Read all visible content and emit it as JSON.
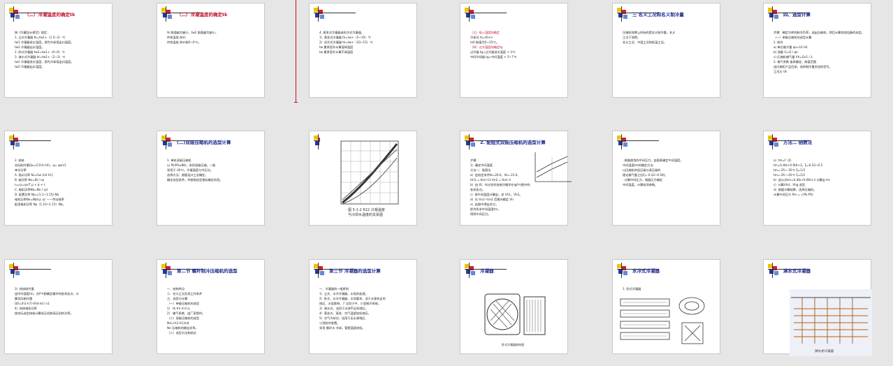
{
  "slides": [
    {
      "title": "（二）冷凝温度的确定tk",
      "title_red": true,
      "lines": [
        "按《冷藏设计规范》规定：",
        "1. 立式冷凝器  tk=tw1+（1.5~3）℃",
        "tw1  冷凝器进水温度，即为冷却塔出口温度。",
        "tw2  冷凝器出水温度。",
        "2. 卧式冷凝器   tw2=tw1+（4~6）℃",
        "3. 淋水式冷凝器   tk=tw1+（2~3）℃",
        "tw1  冷凝器进水温度，即为冷却塔出口温度。",
        "tw2  冷凝器出水温度。"
      ]
    },
    {
      "title": "（二）冷凝温度的确定tk",
      "title_red": true,
      "lines": [
        "tk 取值越大越小，tw2 取值越大越小。",
        "传热温差  Δtm",
        "",
        "",
        "",
        "",
        "",
        "   传热温差  Δtm取5~6℃。"
      ]
    },
    {
      "title": "",
      "lines": [
        "4. 蒸发式冷凝器或风冷式冷凝器。",
        "1）蒸发式冷凝器  tk=tw+（5~10）℃",
        "2）风冷式冷凝器  tk=tw+（10~15）℃",
        "tw  夏季室外计算湿球温度",
        "tw  夏季室外计算干球温度"
      ]
    },
    {
      "title": "",
      "lines": [
        "（三）吸入温度的确定",
        "    冷却式  tx=t0+n",
        "    tx0  取值为5~15℃。",
        "",
        "（四）过冷温度的确定tg",
        "    过冷器  tg=过冷器进水温度 + 3℃",
        "    中间冷却器  tg=中间温度 + 5~7℃"
      ]
    },
    {
      "title": "三  名义工况和名义制冷量",
      "lines": [
        "    压缩机铭牌上所标的是名义制冷量。名义",
        "工况下测得。",
        "    名义工况、中温工况和低温工况。"
      ]
    },
    {
      "title": "四、选型计算",
      "lines": [
        "步骤：确定冷库的制冷负荷，选出压缩机，然后计算其他设备的选型。",
        "（一）单级压缩机的选型计算",
        "1. 制冷",
        "a) 单位制冷量  qe=h1-h4",
        "b) 流量  G=Q / qe",
        "c) 压缩机输气量  Vh=Gv1 / λ",
        "2. 输气系数  查表确定，取值范围",
        "   由压缩机产品目录，选择制冷量合适的型号。",
        "工况与 Vh"
      ]
    },
    {
      "title": "",
      "lines": [
        "2. 校核",
        "   实际制冷量Qe=G'(h1-h4)，q= qe/v1",
        "   单位功率",
        "A. 指示功率  Ni=Gw (h2-h1)",
        "B. 轴功率  Ne=Ni / ηe",
        "   n=ηi=ηe/T  p + b + t",
        "C. 电机功率Nb=Ne / ηd",
        "D. 配置功率 Np=(1.1~1.15) Nb",
        "   电机功率Ne=Nb/ηc              ηc ——传动效率",
        "   配用电机功率 Np（1.10~1.15）Nb。"
      ]
    },
    {
      "title": "(二)双级压缩机的选型计算",
      "lines": [
        "1. 单机双级压缩机",
        "   以 Pk/P0≥8时，采用双级压缩。一般",
        "采用于-30℃。冷凝温度与中压比。",
        "   选择方法：根据设计工况确定，",
        "确定选型条件。并按照选型指标确定机型。"
      ]
    },
    {
      "title": "",
      "lines": []
    },
    {
      "title": "2. 配组式双级压缩机的选型计算",
      "lines": [
        "步骤：",
        "1）确定中间温度",
        "方法一：画图法",
        "a）由给定条件tk=20.0、t0=-23.0、",
        "   tm1 = tkm-13     tm2 = tkm-3",
        "b）由 t0、tk分别作各制冷循环在lgP-h图中的",
        "   各状态点。",
        "c）按中间温度计算出，求 Vh1，Vh2。",
        "d）在 tm1~tm2 范围内确定 Vh",
        "e）由图中得出交点，",
        "   即为所求中间温度tm，",
        "   得到中间压力。"
      ]
    },
    {
      "title": "",
      "lines": [
        "· 根据使用的中间压力，由图表确定中间温度。",
        "  中间温度tm的确定方法：",
        "  以压缩机的低压级与高压级的",
        "  理论输气量之比ξ= 0.33~0.5时。",
        "· 计算中间压力，根据压力确定",
        "  中间温度，计算各项参数。"
      ]
    },
    {
      "title": "方法二 函数法",
      "lines": [
        "a）tm=f（ξ）",
        "   tm=0.4tk+0.6t0+3，ξ=0.33~0.5",
        "   tm=-25~-35℃  ξ=1/3",
        "   tm=-35~-45℃  ξ=1/2",
        "b）由公式tm=0.4tk+0.6t0+3 计算出 tm",
        "c）计算Vhd，Vhg  选型",
        "d）根据计算结果，选择压缩机。",
        "   计算中间压力 Pm = √(Pk·P0)"
      ]
    },
    {
      "title": "",
      "lines": [
        "3）校核制冷量",
        "   由中间温度tm，在P-h图确定循环的各状态点，计",
        "   算实际制冷量",
        "Q0=(h1-h7)·Vhd·λd / v1",
        "4）校核电机功率",
        "   按实际选型校核计算低压机和高压机的功率。"
      ]
    },
    {
      "title": "第二节 螺杆制冷压缩机的选型",
      "lines": [
        "一、结构特点",
        "二、名义工况及其工作条件",
        "三、选型与计算",
        "（一）单级压缩机的选型",
        "1）      tk  tm  m·h·η",
        "2）  输气系数、由厂家提供。",
        "（二）双级压缩机的选型",
        "  Nd=(h2-h1)/ηd",
        "  Ne    压缩机的输出功率。",
        "（二）选型方法和结论"
      ]
    },
    {
      "title": "第三节 冷凝器的选型计算",
      "lines": [
        "一、冷凝器的一般原则",
        "1）立式、水冷冷凝器、水垢的处理。",
        "2）卧式、水冷冷凝器、水质要求、适于水源充足的",
        "   地区、水垢影响、广泛用于中、小型制冷系统。",
        "3）淋水式、适用于水源不足的地区。",
        "4）蒸发式、蒸发、空气温度较低地区。",
        "5）空气冷却式、适用于无水源地区、",
        "   小型制冷装置。",
        "采用 循环水 冷却，管壁温度较低。"
      ]
    },
    {
      "title": "冷凝器",
      "lines": []
    },
    {
      "title": "水冷式冷凝器",
      "lines": [
        "1. 卧式冷凝器"
      ]
    },
    {
      "title": "淋水式冷凝器",
      "lines": []
    }
  ],
  "figure_captions": {
    "chart_cap1": "图 5-1-2  R22 冷凝温度",
    "chart_cap2": "与冷却水温度的关系图",
    "cond_cap": "卧式冷凝器结构图",
    "spray_cap": "淋水式冷凝器"
  },
  "colors": {
    "title_blue": "#1b2a8a",
    "title_red": "#c0142c",
    "accent_yellow": "#f2c200"
  }
}
